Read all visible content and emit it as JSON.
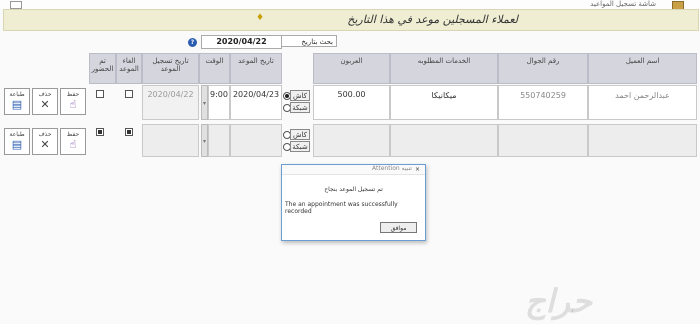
{
  "window": {
    "title": "شاشة تسجيل المواعيد",
    "title_prefix": "..."
  },
  "banner": {
    "title": "لعملاء المسجلين موعد في هذا التاريخ",
    "mark": "♦"
  },
  "search": {
    "label": "بحث بتاريخ",
    "date": "2020/04/22"
  },
  "columns": {
    "customer_name": "اسم العميل",
    "mobile": "رقم الجوال",
    "services": "الخدمات المطلوبه",
    "deposit": "العربون",
    "appt_date": "تاريخ الموعد",
    "time": "الوقت",
    "reg_date": "تاريخ تسجيل الموعد",
    "cancel": "الغاء الموعد",
    "attended": "تم الحضور"
  },
  "rows": [
    {
      "customer_name": "عبدالرحمن احمد",
      "mobile": "550740259",
      "services": "ميكانيكا",
      "deposit": "500.00",
      "appt_date": "2020/04/23",
      "time": "9:00",
      "reg_date": "2020/04/22",
      "cash": "كاش",
      "network": "شبكة",
      "cancel_checked": false,
      "attended_checked": false
    },
    {
      "customer_name": "",
      "mobile": "",
      "services": "",
      "deposit": "",
      "appt_date": "",
      "time": "",
      "reg_date": "",
      "cash": "كاش",
      "network": "شبكة",
      "cancel_checked": true,
      "attended_checked": true
    }
  ],
  "actions": {
    "save": "حفظ",
    "delete": "حذف",
    "print": "طباعة"
  },
  "dialog": {
    "title": "Attention تنبيه",
    "message_ar": "تم تسجيل الموعد بنجاح",
    "message_en": "The an appointment was successfully recorded",
    "ok": "موافق"
  },
  "watermark": "حراج"
}
